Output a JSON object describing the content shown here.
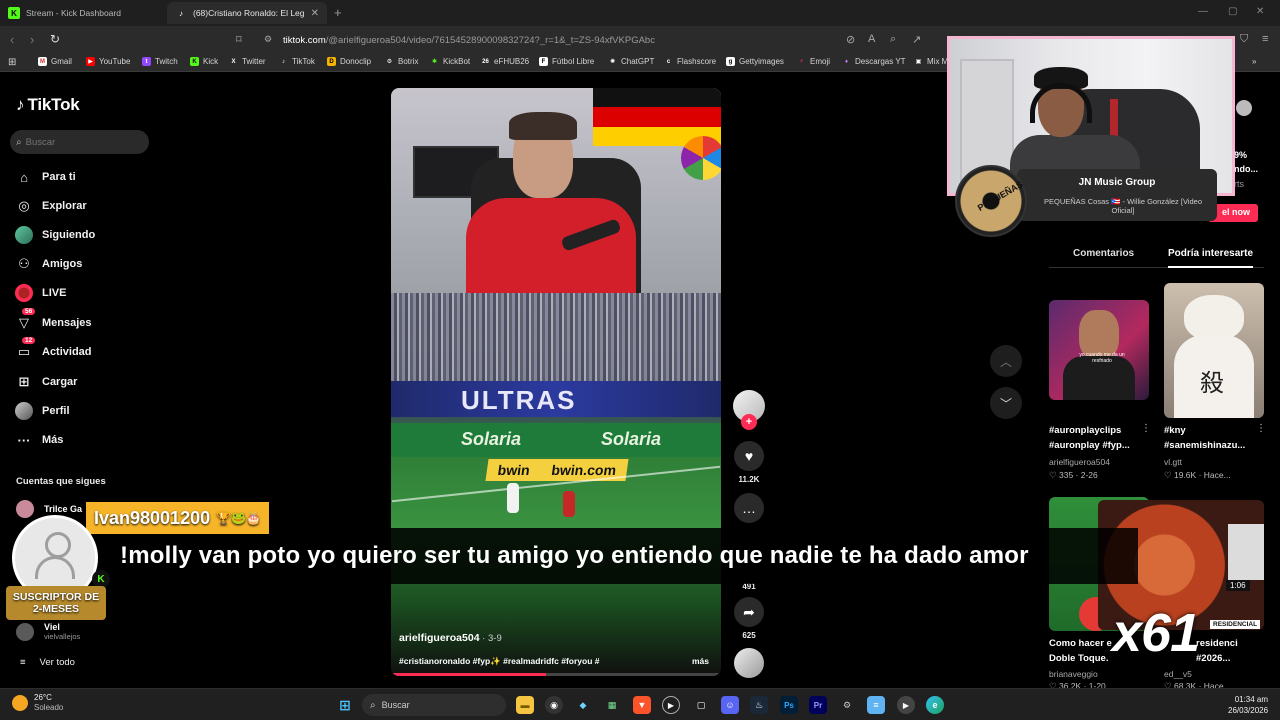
{
  "browser": {
    "tabs": [
      {
        "label": "Stream - Kick Dashboard",
        "icon": "kick-icon"
      },
      {
        "label": "(68)Cristiano Ronaldo: El Leg",
        "icon": "tiktok-icon"
      }
    ],
    "url_host": "tiktok.com",
    "url_path": "/@arielfigueroa504/video/7615452890009832724?_r=1&_t=ZS-94xfVKPGAbc",
    "bookmarks": [
      "Gmail",
      "YouTube",
      "Twitch",
      "Kick",
      "Twitter",
      "TikTok",
      "Donoclip",
      "Botrix",
      "KickBot",
      "eFHUB26",
      "Fútbol Libre",
      "ChatGPT",
      "Flashscore",
      "Gettyimages",
      "Emoji",
      "Descargas YT",
      "Mix M"
    ]
  },
  "tiktok": {
    "brand": "TikTok",
    "search_placeholder": "Buscar",
    "nav": [
      {
        "label": "Para ti",
        "icon": "home-icon"
      },
      {
        "label": "Explorar",
        "icon": "compass-icon"
      },
      {
        "label": "Siguiendo",
        "icon": "following-avatar"
      },
      {
        "label": "Amigos",
        "icon": "friends-icon"
      },
      {
        "label": "LIVE",
        "icon": "live-icon"
      },
      {
        "label": "Mensajes",
        "icon": "messages-icon",
        "badge": "56"
      },
      {
        "label": "Actividad",
        "icon": "activity-icon",
        "badge": "12"
      },
      {
        "label": "Cargar",
        "icon": "upload-icon"
      },
      {
        "label": "Perfil",
        "icon": "profile-avatar"
      },
      {
        "label": "Más",
        "icon": "more-icon"
      }
    ],
    "following_title": "Cuentas que sigues",
    "following": [
      {
        "name": "Trilce Ga",
        "sub": ""
      },
      {
        "name": "Viel",
        "sub": "vielvallejos"
      }
    ],
    "see_all": "Ver todo"
  },
  "video": {
    "banner_text": "ULTRAS",
    "ad_text": "Solaria",
    "bwin": [
      "bwin",
      "bwin.com"
    ],
    "author": "arielfigueroa504",
    "date": "3-9",
    "caption": "#cristianoronaldo #fyp✨ #realmadridfc #foryou #",
    "more": "más",
    "progress": 0.47
  },
  "actions": {
    "likes": "11.2K",
    "comments": "491",
    "shares": "625"
  },
  "right_panel": {
    "tabs": [
      "Comentarios",
      "Podría interesarte"
    ],
    "active_tab": 1,
    "live_now": "el now",
    "partial_texts": [
      "9%",
      "ndo...",
      "rts"
    ],
    "cards": [
      {
        "title": "#auronplayclips #auronplay #fyp...",
        "user": "arielfigueroa504",
        "likes": "335",
        "date": "2-26",
        "thumb_text": "yo cuando me da un resfriado"
      },
      {
        "title": "#kny #sanemishinazu...",
        "user": "vl.gtt",
        "likes": "19.6K",
        "date": "Hace...",
        "thumb_text": "殺"
      },
      {
        "title": "Como hacer e Doble Toque.",
        "user": "brianaveggio",
        "likes": "36.2K",
        "date": "1-20"
      },
      {
        "title": "residenci #2026...",
        "user": "ed__v5",
        "likes": "68.3K",
        "date": "Hace..."
      }
    ],
    "overlay_count": "x61",
    "news_time": "1:06",
    "news_label": "RESIDENCIAL"
  },
  "stream_overlay": {
    "music_title": "JN Music Group",
    "music_subtitle": "PEQUEÑAS Cosas 🇵🇷 - Willie González [Video Oficial]",
    "disc_text": "PEQUEÑAS"
  },
  "chat": {
    "username": "Ivan98001200",
    "emotes": "🏆🐸🎂",
    "message": "!molly van poto yo quiero ser tu amigo yo entiendo que nadie te ha dado amor",
    "badge_line1": "SUSCRIPTOR DE",
    "badge_line2": "2-MESES"
  },
  "taskbar": {
    "temp": "26°C",
    "condition": "Soleado",
    "search": "Buscar",
    "time": "01:34 am",
    "date": "26/03/2026"
  },
  "colors": {
    "tiktok_red": "#fe2c55",
    "kick_green": "#53fc18",
    "chat_name_bg": "#f6b429",
    "sub_badge_bg": "#b68a2c"
  }
}
